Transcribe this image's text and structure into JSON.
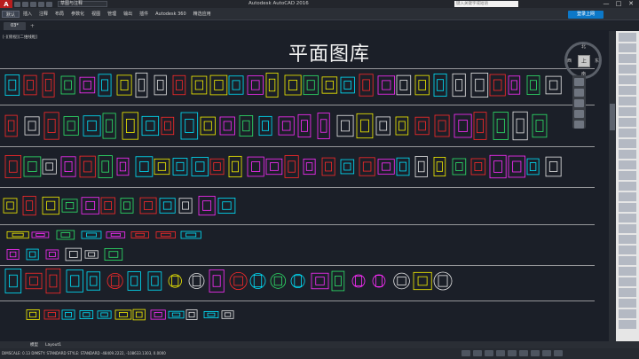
{
  "app": {
    "title": "Autodesk AutoCAD 2016",
    "logo_letter": "A",
    "workspace": "草图与注释",
    "search_placeholder": "键入关键字或短语"
  },
  "window_controls": [
    "—",
    "□",
    "✕"
  ],
  "ribbon": {
    "tabs": [
      "默认",
      "插入",
      "注释",
      "布局",
      "参数化",
      "视图",
      "管理",
      "输出",
      "插件",
      "Autodesk 360",
      "精选应用"
    ],
    "active_index": 0,
    "signin_label": "登录上网"
  },
  "file_tabs": {
    "items": [
      "03*"
    ],
    "add_label": "+"
  },
  "canvas": {
    "viewport_label": "[-][俯视][二维线框]",
    "title": "平面图库"
  },
  "viewcube": {
    "face": "上",
    "north": "北",
    "south": "南",
    "east": "东",
    "west": "西"
  },
  "layout_tabs": [
    "模型",
    "Layout1"
  ],
  "status": {
    "coords": "DIMSCALE: 0.13  DIMSTY: STANDARD  STYLE: STANDARD  -48409.2222, -108633.1303, 0.0000"
  },
  "colors": {
    "background": "#1b1f28",
    "accent": "#0c78c8",
    "cyan": "#00e5ff",
    "yellow": "#f5f000",
    "magenta": "#ff2dff",
    "red": "#ff2a2a",
    "green": "#2ee66a",
    "white": "#e8e8e8"
  },
  "icons": [
    "app-logo-icon",
    "search-icon",
    "signin-icon",
    "viewcube-icon",
    "pan-icon",
    "zoom-icon",
    "orbit-icon"
  ]
}
